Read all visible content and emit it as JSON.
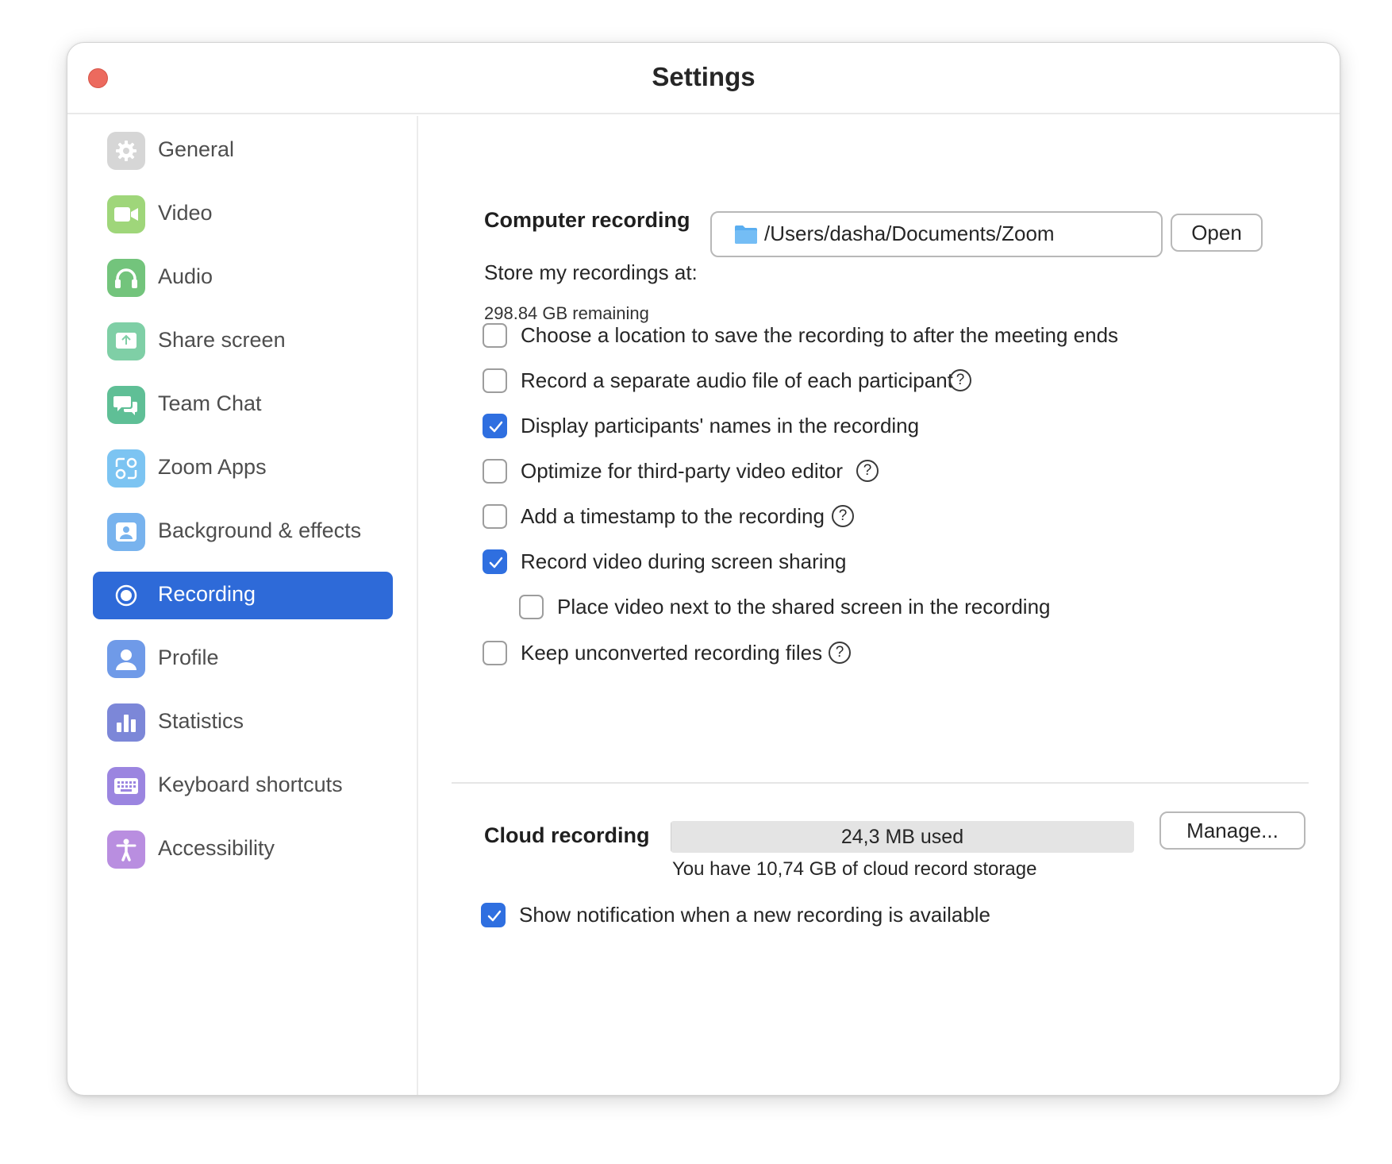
{
  "window": {
    "title": "Settings"
  },
  "sidebar": {
    "items": [
      {
        "label": "General",
        "icon": "gear-icon",
        "color": "#d6d6d6"
      },
      {
        "label": "Video",
        "icon": "video-camera-icon",
        "color": "#9fd67a"
      },
      {
        "label": "Audio",
        "icon": "headphones-icon",
        "color": "#73c47c"
      },
      {
        "label": "Share screen",
        "icon": "share-screen-icon",
        "color": "#7fcfa6"
      },
      {
        "label": "Team Chat",
        "icon": "chat-bubbles-icon",
        "color": "#5fbf96"
      },
      {
        "label": "Zoom Apps",
        "icon": "apps-icon",
        "color": "#7cc4f2"
      },
      {
        "label": "Background & effects",
        "icon": "background-portrait-icon",
        "color": "#78b3ee"
      },
      {
        "label": "Recording",
        "icon": "record-icon",
        "color": "#2e6ad8",
        "active": true
      },
      {
        "label": "Profile",
        "icon": "profile-icon",
        "color": "#6f9ae8"
      },
      {
        "label": "Statistics",
        "icon": "bar-chart-icon",
        "color": "#7c87d8"
      },
      {
        "label": "Keyboard shortcuts",
        "icon": "keyboard-icon",
        "color": "#9b85e0"
      },
      {
        "label": "Accessibility",
        "icon": "accessibility-icon",
        "color": "#b98ee0"
      }
    ]
  },
  "computer_recording": {
    "title": "Computer recording",
    "store_label": "Store my recordings at:",
    "path": "/Users/dasha/Documents/Zoom",
    "open_button": "Open",
    "remaining": "298.84 GB remaining",
    "options": [
      {
        "label": "Choose a location to save the recording to after the meeting ends",
        "checked": false,
        "help": false
      },
      {
        "label": "Record a separate audio file of each participant",
        "checked": false,
        "help": true
      },
      {
        "label": "Display participants' names in the recording",
        "checked": true,
        "help": false
      },
      {
        "label": "Optimize for third-party video editor",
        "checked": false,
        "help": true
      },
      {
        "label": "Add a timestamp to the recording",
        "checked": false,
        "help": true
      },
      {
        "label": "Record video during screen sharing",
        "checked": true,
        "help": false
      },
      {
        "label": "Place video next to the shared screen in the recording",
        "checked": false,
        "help": false,
        "indented": true
      },
      {
        "label": "Keep unconverted recording files",
        "checked": false,
        "help": true
      }
    ],
    "help_glyph": "?"
  },
  "cloud_recording": {
    "title": "Cloud recording",
    "usage_text": "24,3 MB used",
    "usage_fraction": 0.002,
    "storage_text": "You have 10,74 GB of cloud record storage",
    "manage_button": "Manage...",
    "notification_label": "Show notification when a new recording is available",
    "notification_checked": true
  },
  "colors": {
    "accent": "#2e6ad8",
    "checkbox_checked": "#2f6fe0",
    "close_button": "#ec6a5e"
  }
}
